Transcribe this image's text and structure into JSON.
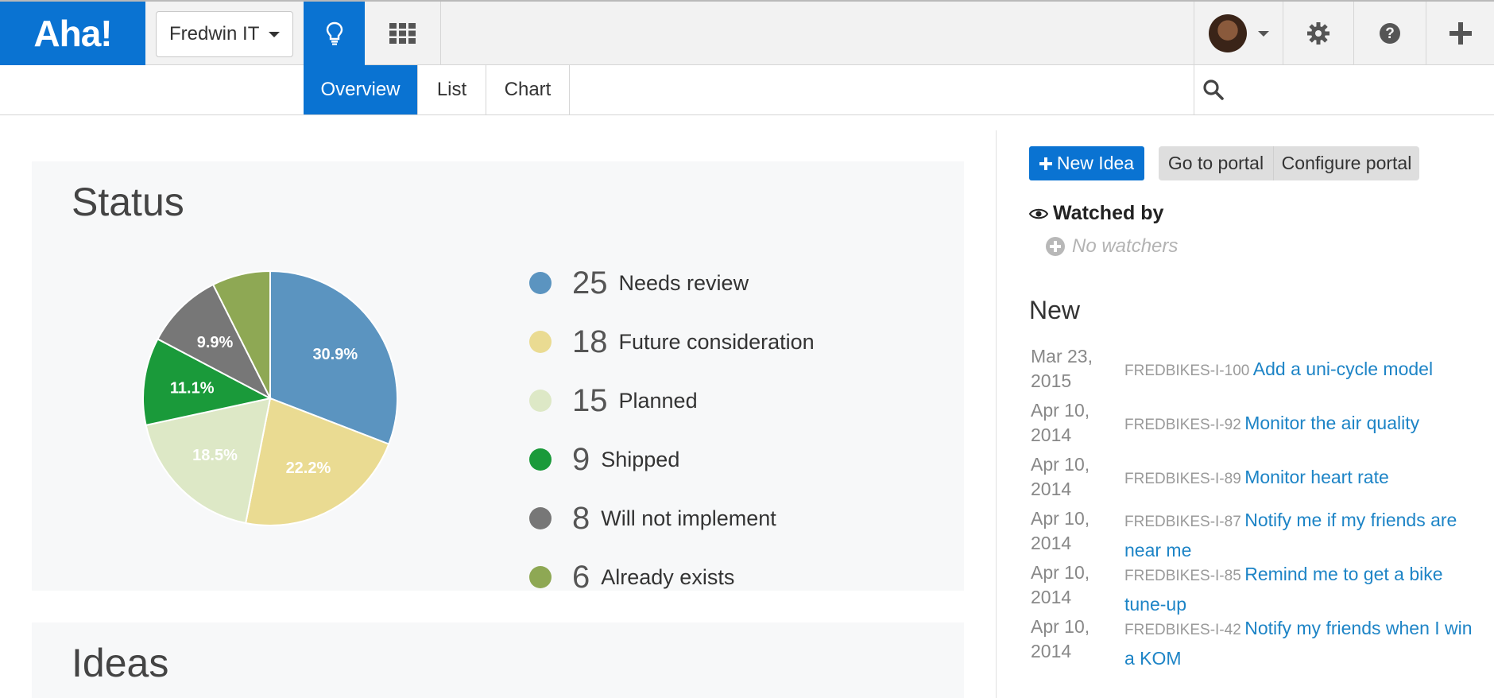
{
  "header": {
    "logo": "Aha!",
    "workspace": "Fredwin IT",
    "icons": [
      "lightbulb-icon",
      "grid-icon",
      "avatar",
      "gear-icon",
      "help-icon",
      "plus-icon"
    ]
  },
  "subnav": {
    "tabs": [
      {
        "label": "Overview",
        "active": true
      },
      {
        "label": "List",
        "active": false
      },
      {
        "label": "Chart",
        "active": false
      }
    ],
    "search_placeholder": ""
  },
  "status": {
    "title": "Status",
    "legend": [
      {
        "count": "25",
        "label": "Needs review"
      },
      {
        "count": "18",
        "label": "Future consideration"
      },
      {
        "count": "15",
        "label": "Planned"
      },
      {
        "count": "9",
        "label": "Shipped"
      },
      {
        "count": "8",
        "label": "Will not implement"
      },
      {
        "count": "6",
        "label": "Already exists"
      }
    ]
  },
  "chart_data": {
    "type": "pie",
    "categories": [
      "Needs review",
      "Future consideration",
      "Planned",
      "Shipped",
      "Will not implement",
      "Already exists"
    ],
    "values": [
      25,
      18,
      15,
      9,
      8,
      6
    ],
    "slice_labels": [
      "30.9%",
      "22.2%",
      "18.5%",
      "11.1%",
      "9.9%",
      ""
    ],
    "colors": [
      "#5b94c0",
      "#eadb92",
      "#dde8c6",
      "#1a9a3a",
      "#777777",
      "#8ea854"
    ]
  },
  "ideas": {
    "title": "Ideas"
  },
  "sidebar": {
    "new_idea": "New Idea",
    "go_to_portal": "Go to portal",
    "configure_portal": "Configure portal",
    "watched_by": "Watched by",
    "no_watchers": "No watchers",
    "new_heading": "New",
    "new_items": [
      {
        "date": "Mar 23, 2015",
        "ref": "FREDBIKES-I-100",
        "title": "Add a uni-cycle model"
      },
      {
        "date": "Apr 10, 2014",
        "ref": "FREDBIKES-I-92",
        "title": "Monitor the air quality"
      },
      {
        "date": "Apr 10, 2014",
        "ref": "FREDBIKES-I-89",
        "title": "Monitor heart rate"
      },
      {
        "date": "Apr 10, 2014",
        "ref": "FREDBIKES-I-87",
        "title": "Notify me if my friends are near me"
      },
      {
        "date": "Apr 10, 2014",
        "ref": "FREDBIKES-I-85",
        "title": "Remind me to get a bike tune-up"
      },
      {
        "date": "Apr 10, 2014",
        "ref": "FREDBIKES-I-42",
        "title": "Notify my friends when I win a KOM"
      }
    ]
  }
}
